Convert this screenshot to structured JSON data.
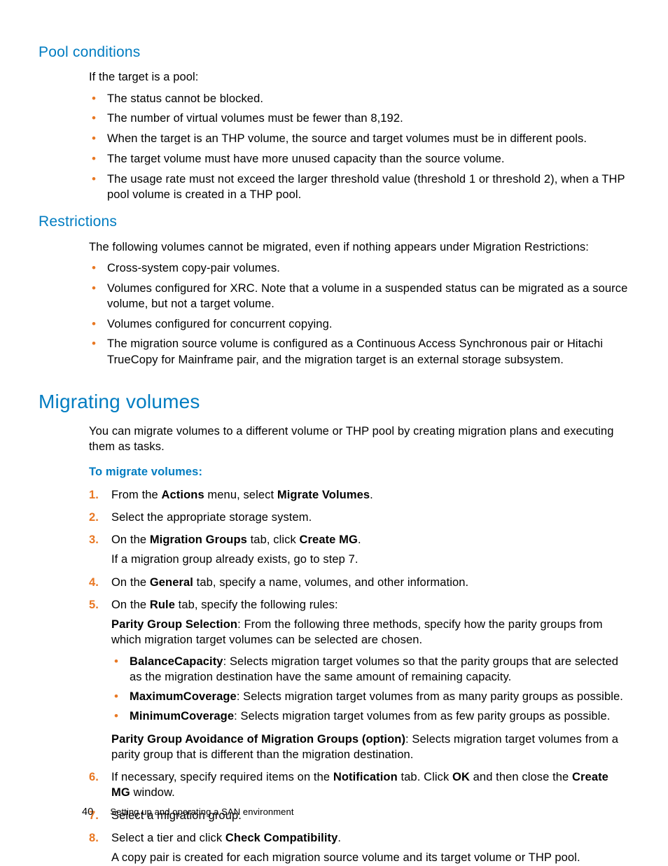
{
  "sections": {
    "pool": {
      "heading": "Pool conditions",
      "intro": "If the target is a pool:",
      "items": [
        "The status cannot be blocked.",
        "The number of virtual volumes must be fewer than 8,192.",
        "When the target is an THP volume, the source and target volumes must be in different pools.",
        "The target volume must have more unused capacity than the source volume.",
        "The usage rate must not exceed the larger threshold value (threshold 1 or threshold 2), when a THP pool volume is created in a THP pool."
      ]
    },
    "restrictions": {
      "heading": "Restrictions",
      "intro": "The following volumes cannot be migrated, even if nothing appears under Migration Restrictions:",
      "items": [
        "Cross-system copy-pair volumes.",
        "Volumes configured for XRC. Note that a volume in a suspended status can be migrated as a source volume, but not a target volume.",
        "Volumes configured for concurrent copying.",
        "The migration source volume is configured as a Continuous Access Synchronous pair or Hitachi TrueCopy for Mainframe pair, and the migration target is an external storage subsystem."
      ]
    },
    "migrating": {
      "heading": "Migrating volumes",
      "intro": "You can migrate volumes to a different volume or THP pool by creating migration plans and executing them as tasks.",
      "procTitle": "To migrate volumes:",
      "step1_pre": "From the ",
      "step1_b1": "Actions",
      "step1_mid": " menu, select ",
      "step1_b2": "Migrate Volumes",
      "step1_post": ".",
      "step2": "Select the appropriate storage system.",
      "step3_pre": "On the ",
      "step3_b1": "Migration Groups",
      "step3_mid": " tab, click ",
      "step3_b2": "Create MG",
      "step3_post": ".",
      "step3_note": "If a migration group already exists, go to step 7.",
      "step4_pre": "On the ",
      "step4_b1": "General",
      "step4_post": " tab, specify a name, volumes, and other information.",
      "step5_pre": "On the ",
      "step5_b1": "Rule",
      "step5_post": " tab, specify the following rules:",
      "step5_pgs_b": "Parity Group Selection",
      "step5_pgs_txt": ": From the following three methods, specify how the parity groups from which migration target volumes can be selected are chosen.",
      "step5_bal_b": "BalanceCapacity",
      "step5_bal_txt": ": Selects migration target volumes so that the parity groups that are selected as the migration destination have the same amount of remaining capacity.",
      "step5_max_b": "MaximumCoverage",
      "step5_max_txt": ": Selects migration target volumes from as many parity groups as possible.",
      "step5_min_b": "MinimumCoverage",
      "step5_min_txt": ": Selects migration target volumes from as few parity groups as possible.",
      "step5_avoid_b": "Parity Group Avoidance of Migration Groups (option)",
      "step5_avoid_txt": ": Selects migration target volumes from a parity group that is different than the migration destination.",
      "step6_pre": "If necessary, specify required items on the ",
      "step6_b1": "Notification",
      "step6_mid": " tab. Click ",
      "step6_b2": "OK",
      "step6_mid2": " and then close the ",
      "step6_b3": "Create MG",
      "step6_post": " window.",
      "step7": "Select a migration group.",
      "step8_pre": "Select a tier and click ",
      "step8_b1": "Check Compatibility",
      "step8_post": ".",
      "step8_note": "A copy pair is created for each migration source volume and its target volume or THP pool."
    }
  },
  "footer": {
    "page": "40",
    "title": "Setting up and operating a SAN environment"
  }
}
